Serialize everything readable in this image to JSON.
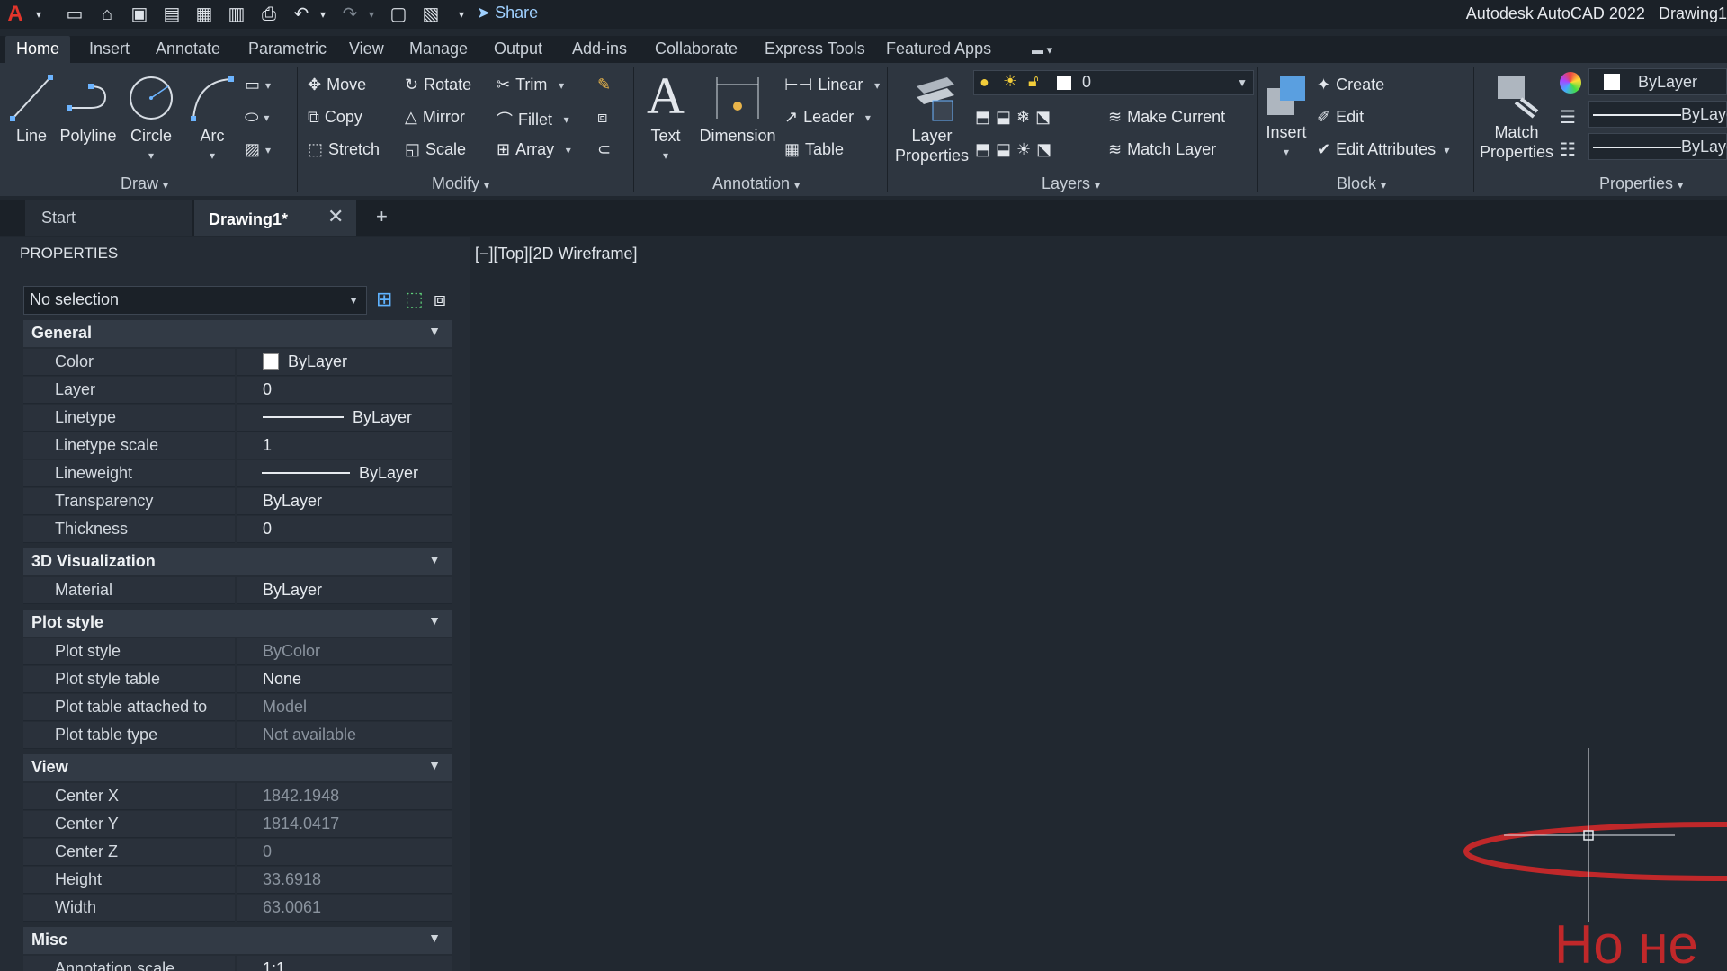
{
  "title": {
    "app": "Autodesk AutoCAD 2022",
    "doc": "Drawing1",
    "share": "Share"
  },
  "ribbon_tabs": [
    "Home",
    "Insert",
    "Annotate",
    "Parametric",
    "View",
    "Manage",
    "Output",
    "Add-ins",
    "Collaborate",
    "Express Tools",
    "Featured Apps"
  ],
  "draw": {
    "title": "Draw",
    "line": "Line",
    "polyline": "Polyline",
    "circle": "Circle",
    "arc": "Arc"
  },
  "modify": {
    "title": "Modify",
    "move": "Move",
    "rotate": "Rotate",
    "trim": "Trim",
    "copy": "Copy",
    "mirror": "Mirror",
    "fillet": "Fillet",
    "stretch": "Stretch",
    "scale": "Scale",
    "array": "Array"
  },
  "annotation": {
    "title": "Annotation",
    "text": "Text",
    "dimension": "Dimension",
    "linear": "Linear",
    "leader": "Leader",
    "table": "Table"
  },
  "layers": {
    "title": "Layers",
    "layer_properties_1": "Layer",
    "layer_properties_2": "Properties",
    "current_layer": "0",
    "make_current": "Make Current",
    "match_layer": "Match Layer"
  },
  "block": {
    "title": "Block",
    "insert": "Insert",
    "create": "Create",
    "edit": "Edit",
    "edit_attributes": "Edit Attributes"
  },
  "properties_panel": {
    "title": "Properties",
    "match_1": "Match",
    "match_2": "Properties",
    "color": "ByLayer",
    "lineweight": "ByLaye",
    "linetype": "ByLaye"
  },
  "doc_tabs": {
    "start": "Start",
    "drawing": "Drawing1*"
  },
  "palette": {
    "title": "PROPERTIES",
    "selection": "No selection",
    "sections": {
      "general": "General",
      "vis3d": "3D Visualization",
      "plot": "Plot style",
      "view": "View",
      "misc": "Misc"
    },
    "general": [
      {
        "k": "Color",
        "v": "ByLayer"
      },
      {
        "k": "Layer",
        "v": "0"
      },
      {
        "k": "Linetype",
        "v": "ByLayer"
      },
      {
        "k": "Linetype scale",
        "v": "1"
      },
      {
        "k": "Lineweight",
        "v": "ByLayer"
      },
      {
        "k": "Transparency",
        "v": "ByLayer"
      },
      {
        "k": "Thickness",
        "v": "0"
      }
    ],
    "vis3d": [
      {
        "k": "Material",
        "v": "ByLayer"
      }
    ],
    "plot": [
      {
        "k": "Plot style",
        "v": "ByColor"
      },
      {
        "k": "Plot style table",
        "v": "None"
      },
      {
        "k": "Plot table attached to",
        "v": "Model"
      },
      {
        "k": "Plot table type",
        "v": "Not available"
      }
    ],
    "view": [
      {
        "k": "Center X",
        "v": "1842.1948"
      },
      {
        "k": "Center Y",
        "v": "1814.0417"
      },
      {
        "k": "Center Z",
        "v": "0"
      },
      {
        "k": "Height",
        "v": "33.6918"
      },
      {
        "k": "Width",
        "v": "63.0061"
      }
    ],
    "misc": [
      {
        "k": "Annotation scale",
        "v": "1:1"
      }
    ]
  },
  "viewport": {
    "label": "[−][Top][2D Wireframe]",
    "drawing_text": "Но не"
  }
}
